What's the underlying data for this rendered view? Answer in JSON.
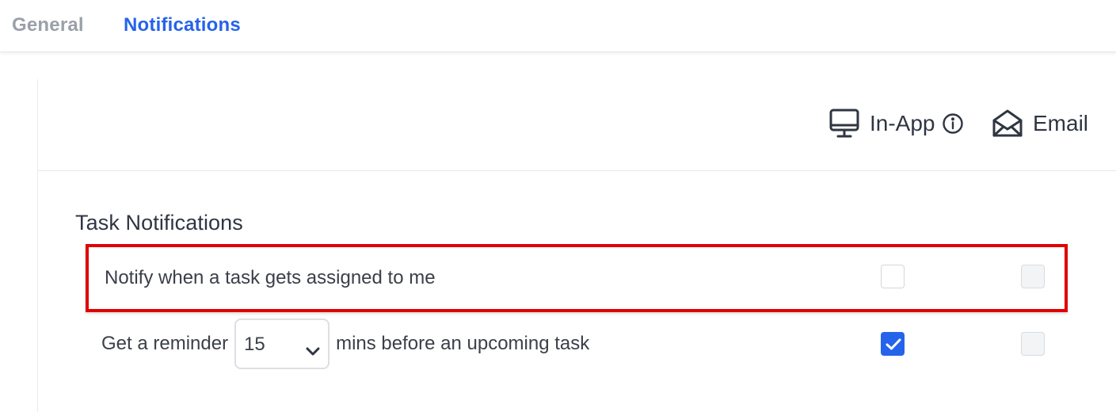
{
  "tabs": [
    {
      "label": "General",
      "active": false
    },
    {
      "label": "Notifications",
      "active": true
    }
  ],
  "channels": {
    "inapp": {
      "label": "In-App",
      "icon": "monitor-icon"
    },
    "email": {
      "label": "Email",
      "icon": "envelope-open-icon"
    }
  },
  "section": {
    "title": "Task Notifications",
    "rows": [
      {
        "label": "Notify when a task gets assigned to me",
        "inapp_checked": false,
        "email_checked": false,
        "email_disabled": true
      },
      {
        "label_before": "Get a reminder",
        "select_value": "15",
        "label_after": "mins before an upcoming task",
        "inapp_checked": true,
        "email_checked": false,
        "email_disabled": true
      }
    ]
  },
  "colors": {
    "accent": "#2563eb",
    "highlight_border": "#e00000",
    "inactive_tab": "#9aa0a8"
  }
}
